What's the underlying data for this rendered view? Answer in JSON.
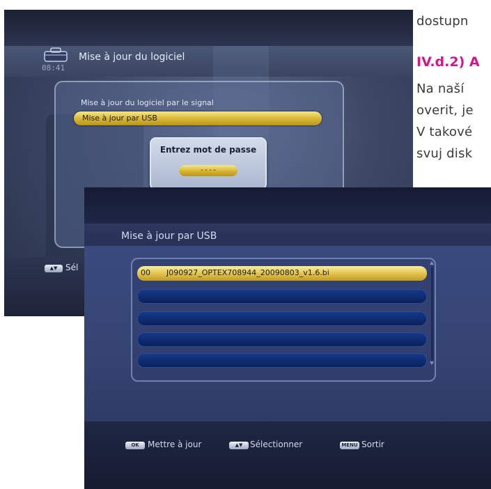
{
  "document": {
    "lines": [
      "dostupn",
      "Na naší",
      "overit, je",
      "V takové",
      "svuj disk"
    ],
    "heading": "IV.d.2) A"
  },
  "back_screen": {
    "title": "Mise à jour du logiciel",
    "time": "08:41",
    "options": [
      "Mise à jour du logiciel par le signal",
      "Mise à jour par USB"
    ],
    "selected_option": 1,
    "password_dialog": {
      "title": "Entrez mot de passe",
      "field_value": "----"
    },
    "footer": {
      "key_label": "▲▼",
      "action": "Sél"
    }
  },
  "front_screen": {
    "title": "Mise à jour par USB",
    "file_list": [
      {
        "index": "00",
        "name": "J090927_OPTEX708944_20090803_v1.6.bi",
        "selected": true
      },
      {
        "index": "",
        "name": "",
        "selected": false
      },
      {
        "index": "",
        "name": "",
        "selected": false
      },
      {
        "index": "",
        "name": "",
        "selected": false
      },
      {
        "index": "",
        "name": "",
        "selected": false
      }
    ],
    "footer": [
      {
        "key": "OK",
        "label": "Mettre à jour",
        "icon": "ok-key-icon"
      },
      {
        "key": "▲▼",
        "label": "Sélectionner",
        "icon": "up-down-key-icon"
      },
      {
        "key": "MENU",
        "label": "Sortir",
        "icon": "menu-key-icon"
      }
    ]
  },
  "colors": {
    "heading_magenta": "#d4148c",
    "highlight_gold": "#e0c14a",
    "row_blue": "#0f2a6c",
    "screen_navy": "#232b4f"
  }
}
